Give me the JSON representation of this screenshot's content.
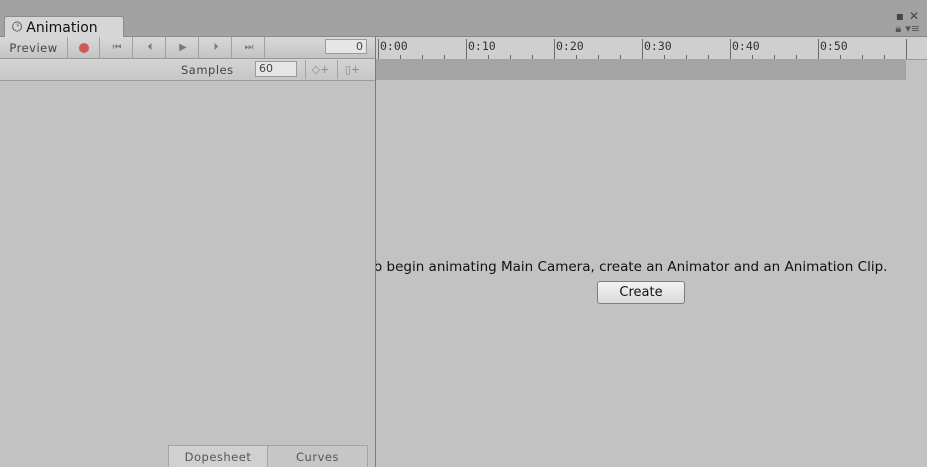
{
  "window": {
    "tab_title": "Animation",
    "tab_icon": "clock-icon",
    "control_icons": [
      "maximize-icon",
      "close-icon"
    ],
    "menu_icons": [
      "lock-icon",
      "context-menu-icon"
    ]
  },
  "toolbar": {
    "preview_label": "Preview",
    "record_color": "#cc5a55",
    "nav_buttons": [
      {
        "name": "first-frame",
        "glyph": "⏮"
      },
      {
        "name": "prev-key",
        "glyph": "⏴"
      },
      {
        "name": "play",
        "glyph": "▶"
      },
      {
        "name": "next-key",
        "glyph": "⏵"
      },
      {
        "name": "last-frame",
        "glyph": "⏭"
      }
    ],
    "frame_value": "0"
  },
  "samples": {
    "label": "Samples",
    "value": "60",
    "add_keyframe_glyph": "◇+",
    "add_event_glyph": "▯+"
  },
  "timeline": {
    "labels": [
      "0:00",
      "0:10",
      "0:20",
      "0:30",
      "0:40",
      "0:50"
    ]
  },
  "main": {
    "message": "To begin animating Main Camera, create an Animator and an Animation Clip.",
    "create_label": "Create"
  },
  "bottom_tabs": {
    "dopesheet": "Dopesheet",
    "curves": "Curves"
  }
}
